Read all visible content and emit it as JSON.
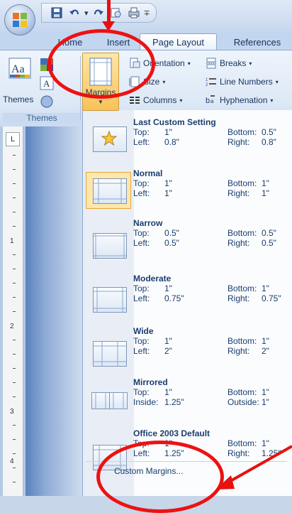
{
  "tabs": [
    "Home",
    "Insert",
    "Page Layout",
    "References"
  ],
  "ribbon": {
    "themes_label": "Themes",
    "themes_group_label": "Themes",
    "margins_label": "Margins",
    "orientation_label": "Orientation",
    "size_label": "Size",
    "columns_label": "Columns",
    "breaks_label": "Breaks",
    "line_numbers_label": "Line Numbers",
    "hyphenation_label": "Hyphenation"
  },
  "margins_menu": [
    {
      "title": "Last Custom Setting",
      "k1": "Top:",
      "v1": "1\"",
      "k2": "Bottom:",
      "v2": "0.5\"",
      "k3": "Left:",
      "v3": "0.8\"",
      "k4": "Right:",
      "v4": "0.8\""
    },
    {
      "title": "Normal",
      "k1": "Top:",
      "v1": "1\"",
      "k2": "Bottom:",
      "v2": "1\"",
      "k3": "Left:",
      "v3": "1\"",
      "k4": "Right:",
      "v4": "1\""
    },
    {
      "title": "Narrow",
      "k1": "Top:",
      "v1": "0.5\"",
      "k2": "Bottom:",
      "v2": "0.5\"",
      "k3": "Left:",
      "v3": "0.5\"",
      "k4": "Right:",
      "v4": "0.5\""
    },
    {
      "title": "Moderate",
      "k1": "Top:",
      "v1": "1\"",
      "k2": "Bottom:",
      "v2": "1\"",
      "k3": "Left:",
      "v3": "0.75\"",
      "k4": "Right:",
      "v4": "0.75\""
    },
    {
      "title": "Wide",
      "k1": "Top:",
      "v1": "1\"",
      "k2": "Bottom:",
      "v2": "1\"",
      "k3": "Left:",
      "v3": "2\"",
      "k4": "Right:",
      "v4": "2\""
    },
    {
      "title": "Mirrored",
      "k1": "Top:",
      "v1": "1\"",
      "k2": "Bottom:",
      "v2": "1\"",
      "k3": "Inside:",
      "v3": "1.25\"",
      "k4": "Outside:",
      "v4": "1\""
    },
    {
      "title": "Office 2003 Default",
      "k1": "Top:",
      "v1": "1\"",
      "k2": "Bottom:",
      "v2": "1\"",
      "k3": "Left:",
      "v3": "1.25\"",
      "k4": "Right:",
      "v4": "1.25\""
    }
  ],
  "custom_margins_label": "Custom Margins...",
  "ruler_numbers": [
    "1",
    "2",
    "3",
    "4"
  ],
  "ruler_corner": "L",
  "colors": {
    "annotation": "#ee1111",
    "selected_fill": "#fde7ad",
    "accent": "#1a3d6e"
  }
}
